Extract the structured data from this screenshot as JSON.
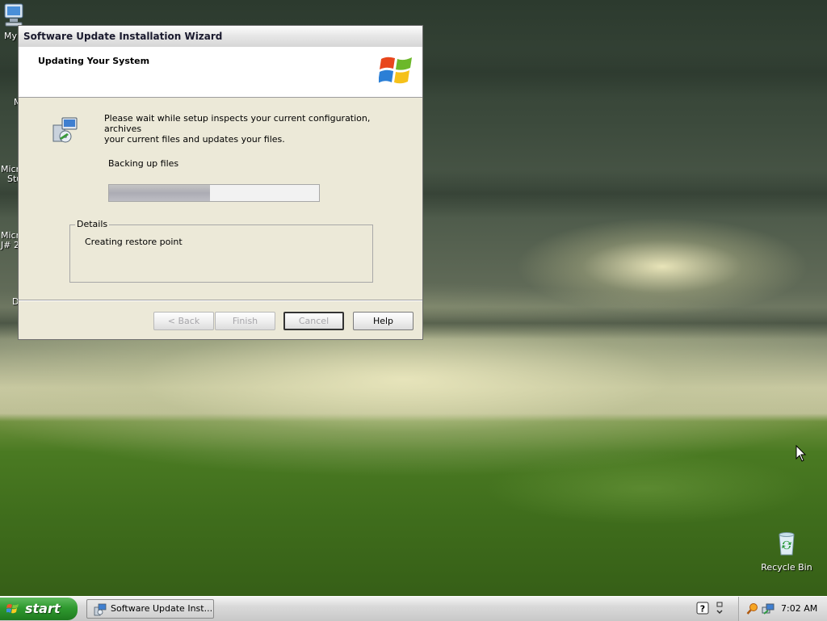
{
  "desktop": {
    "icons": {
      "my_computer_partial": "My",
      "recycle_bin": "Recycle Bin"
    },
    "clipped_labels": [
      "M",
      "Micro",
      "Stu",
      "Micro",
      "J# 2",
      "D"
    ]
  },
  "wizard": {
    "title": "Software Update Installation Wizard",
    "header_title": "Updating Your System",
    "intro_line1": "Please wait while setup inspects your current configuration, archives",
    "intro_line2": "your current files and updates your files.",
    "status": "Backing up files",
    "progress": 0.48,
    "details_label": "Details",
    "details_text": "Creating restore point",
    "buttons": {
      "back": "< Back",
      "finish": "Finish",
      "cancel": "Cancel",
      "help": "Help"
    }
  },
  "taskbar": {
    "start_label": "start",
    "task_item": "Software Update Inst...",
    "clock": "7:02 AM"
  },
  "icon_names": [
    "my-computer-icon",
    "setup-icon",
    "windows-logo-icon",
    "recycle-bin-icon",
    "windows-flag-icon",
    "help-icon",
    "chevron-icon",
    "search-icon",
    "network-icon",
    "mouse-cursor-icon"
  ]
}
